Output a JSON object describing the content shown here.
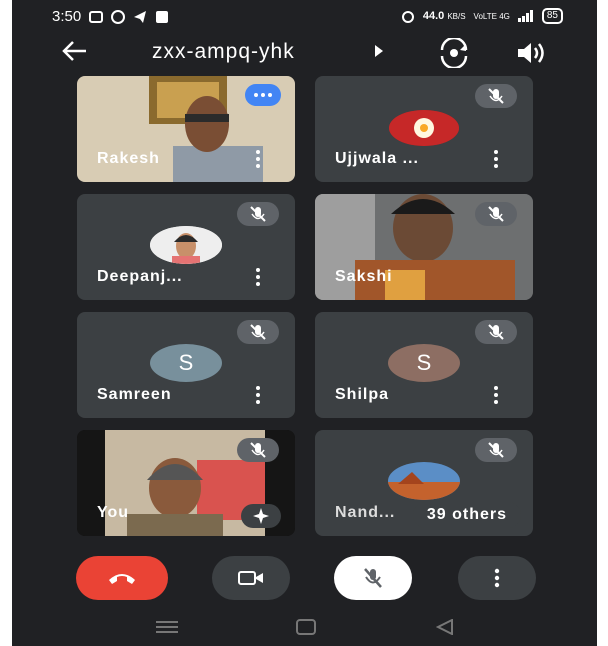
{
  "status_bar": {
    "time": "3:50",
    "speed": "44.0",
    "speed_unit": "KB/S",
    "network": "VoLTE 4G",
    "battery": "85"
  },
  "meeting": {
    "code": "zxx-ampq-yhk"
  },
  "participants": [
    {
      "name": "Rakesh",
      "muted": false,
      "has_options": true
    },
    {
      "name": "Ujjwala ...",
      "muted": true
    },
    {
      "name": "Deepanj...",
      "muted": true
    },
    {
      "name": "Sakshi",
      "muted": true
    },
    {
      "name": "Samreen",
      "initial": "S",
      "avatar_color": "#78909c",
      "muted": true
    },
    {
      "name": "Shilpa",
      "initial": "S",
      "avatar_color": "#8d6e63",
      "muted": true
    },
    {
      "name": "You",
      "muted": true
    },
    {
      "name": "Nand...",
      "muted": true,
      "others_label": "39 others"
    }
  ],
  "controls": {
    "end_call_color": "#ea4335",
    "mic_state": "muted"
  },
  "colors": {
    "background": "#202124",
    "tile": "#3c4043",
    "accent_blue": "#4285f4"
  }
}
